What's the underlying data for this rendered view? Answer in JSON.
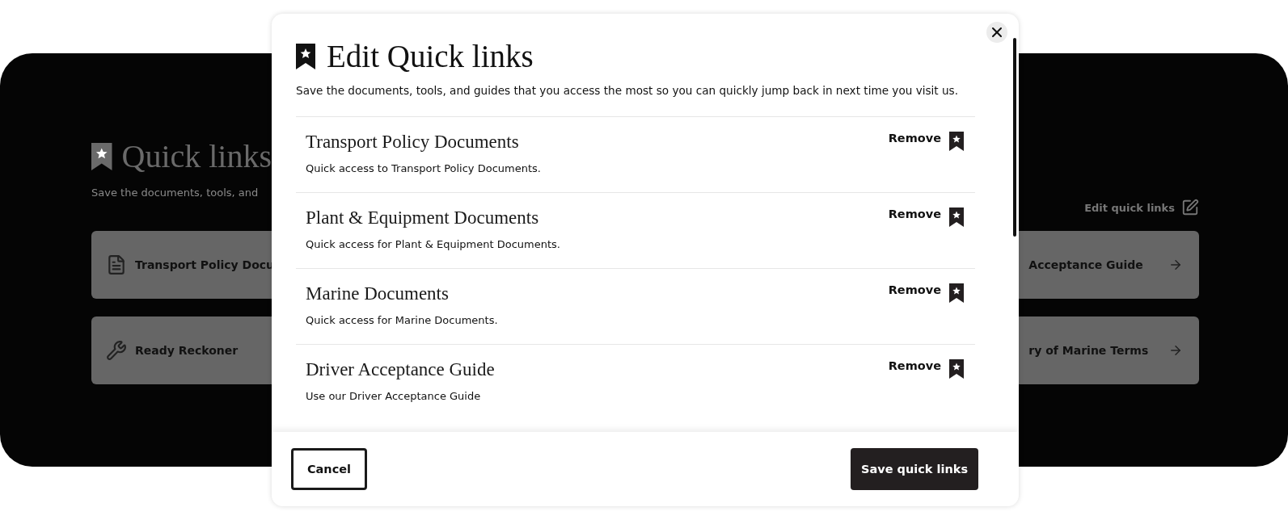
{
  "background": {
    "title": "Quick links",
    "description": "Save the documents, tools, and",
    "edit_link": "Edit quick links",
    "left_cards": [
      {
        "label": "Transport Policy Docu"
      },
      {
        "label": "Ready Reckoner"
      }
    ],
    "right_cards": [
      {
        "label": "Acceptance Guide"
      },
      {
        "label": "ry of Marine Terms"
      }
    ]
  },
  "modal": {
    "title": "Edit Quick links",
    "description": "Save the documents, tools, and guides that you access the most so you can quickly jump back in next time you visit us.",
    "items": [
      {
        "title": "Transport Policy Documents",
        "description": "Quick access to Transport Policy Documents.",
        "action": "Remove"
      },
      {
        "title": "Plant & Equipment Documents",
        "description": "Quick access for Plant & Equipment Documents.",
        "action": "Remove"
      },
      {
        "title": "Marine Documents",
        "description": "Quick access for Marine Documents.",
        "action": "Remove"
      },
      {
        "title": "Driver Acceptance Guide",
        "description": "Use our Driver Acceptance Guide",
        "action": "Remove"
      }
    ],
    "cancel_button": "Cancel",
    "save_button": "Save quick links"
  }
}
